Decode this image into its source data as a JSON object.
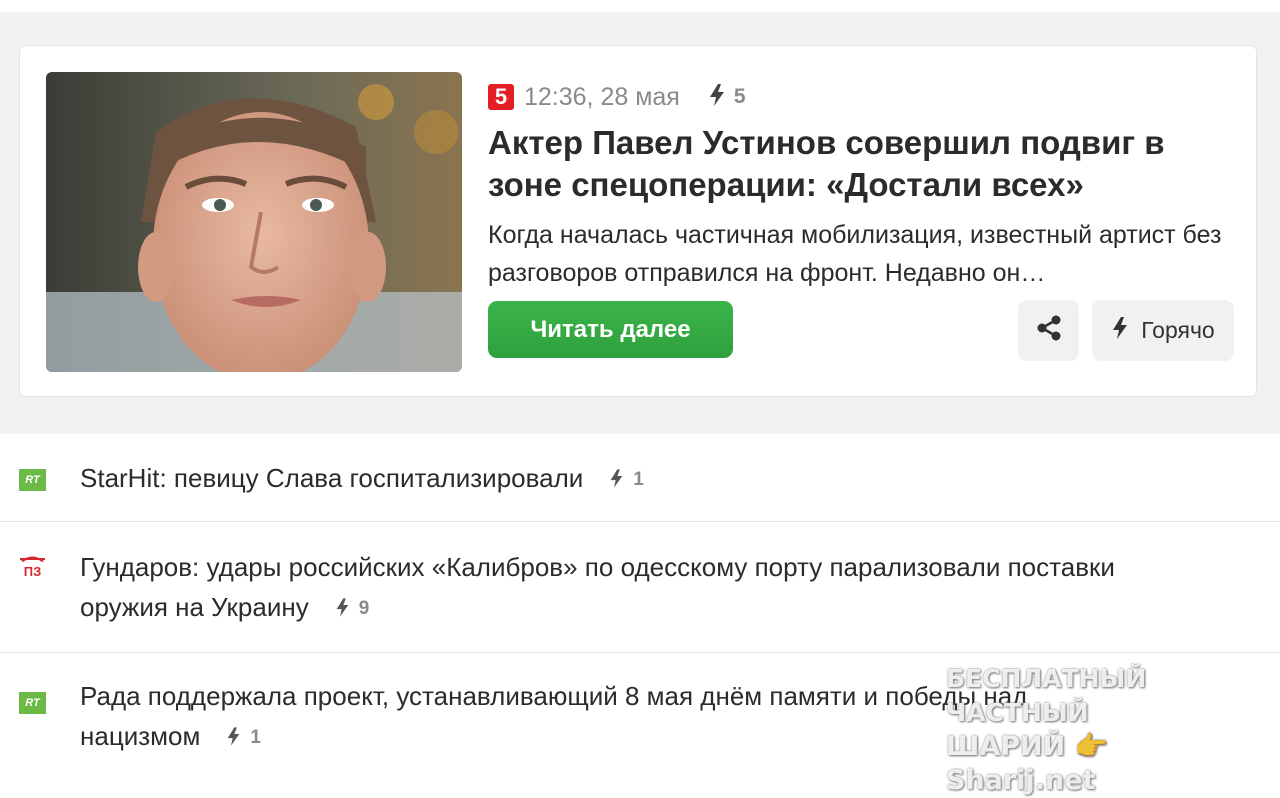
{
  "featured": {
    "source_logo": "5",
    "source_color": "#e31e25",
    "time": "12:36, 28 мая",
    "hot_count": "5",
    "headline": "Актер Павел Устинов совершил подвиг в зоне спецоперации: «Достали всех»",
    "summary": "Когда началась частичная мобилизация, известный артист без разговоров отправился на фронт. Недавно он…",
    "read_more": "Читать далее",
    "hot_label": "Горячо"
  },
  "news": [
    {
      "logo": "RT",
      "title": "StarHit: певицу Слава госпитализировали",
      "hot_count": "1"
    },
    {
      "logo": "ПЗ",
      "title": "Гундаров: удары российских «Калибров» по одесскому порту парализовали поставки оружия на Украину",
      "hot_count": "9"
    },
    {
      "logo": "RT",
      "title": "Рада поддержала проект, устанавливающий 8 мая днём памяти и победы над нацизмом",
      "hot_count": "1"
    }
  ],
  "watermark": {
    "line1": "БЕСПЛАТНЫЙ ЧАСТНЫЙ",
    "line2": "ШАРИЙ 👉 Sharij.net"
  },
  "colors": {
    "accent_green": "#34a843",
    "rt_green": "#6cba45",
    "pz_red": "#d7262d"
  }
}
